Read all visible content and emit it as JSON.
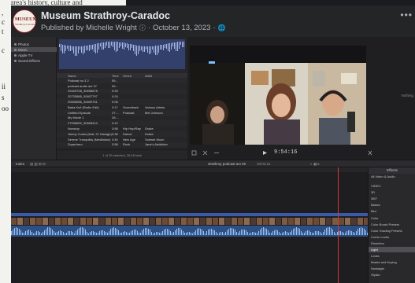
{
  "background_article": {
    "top_text": "the area's history, culture and",
    "fragments": [
      ",",
      "c",
      "t",
      "c",
      "ii",
      "s",
      "oo"
    ]
  },
  "post": {
    "logo": {
      "line1": "MUSEUM",
      "line2": "Strathroy-Caradoc"
    },
    "page_name": "Museum Strathroy-Caradoc",
    "published_by": "Published by Michelle Wright",
    "date": "October 13, 2023",
    "more_label": "•••"
  },
  "editor": {
    "sidebar": [
      {
        "label": "Photos"
      },
      {
        "label": "Music"
      },
      {
        "label": "Apple TV"
      },
      {
        "label": "Sound Effects"
      }
    ],
    "browser": {
      "columns": [
        "Name",
        "Time",
        "Genre",
        "Artist"
      ],
      "rows": [
        [
          "Podcast no 3 2",
          "59...",
          "",
          ""
        ],
        [
          "podcast audio act 37",
          "59...",
          "",
          ""
        ],
        [
          "20426708_30896878",
          "0:25",
          "",
          ""
        ],
        [
          "20733885_30807797",
          "0:24",
          "",
          ""
        ],
        [
          "20635086_30809751",
          "0:06",
          "",
          ""
        ],
        [
          "Baba Kufi (Radio Edit)",
          "3:17",
          "Soundtrack",
          "Various Artists"
        ],
        [
          "Untitled Episode",
          "27:...",
          "Podcast",
          "Mel Johnson"
        ],
        [
          "My Movie 1",
          "26:...",
          "",
          ""
        ],
        [
          "27096652_30808410",
          "0:12",
          "",
          ""
        ],
        [
          "Nonstop",
          "3:58",
          "Hip Hop/Rap",
          "Drake"
        ],
        [
          "Jimmy Cooks (feat. 21 Savage)",
          "3:38",
          "Dance",
          "Drake"
        ],
        [
          "Serene Tranquility (Meditation)",
          "3:40",
          "New Age",
          "Soleste Moon"
        ],
        [
          "Superhero",
          "3:58",
          "Rock",
          "Jane's Addiction"
        ]
      ],
      "status": "1 of 25 selected, 26:18 total"
    },
    "viewer": {
      "side_text": "Nothing",
      "timecode": "9:54:16"
    },
    "timeline_bar": {
      "left_label": "Index",
      "project_label": "strathroy podcast act 25",
      "duration": "10:01:21"
    },
    "effects": {
      "title": "Effects",
      "subtitle": "All Video & Audio",
      "items": [
        "VIDEO",
        "3D",
        "360°",
        "Basics",
        "Blur",
        "Color",
        "Color Board Presets",
        "Color Grading Presets",
        "Comic Looks",
        "Distortion",
        "Light",
        "Looks",
        "Masks and Keying",
        "Nostalgia",
        "Stylize"
      ],
      "selected": "Light"
    },
    "timeline_clip": {
      "label": "strathroy podcast act 25"
    }
  },
  "colors": {
    "accent_blue": "#3b5ba8",
    "playhead": "#d23a3a",
    "audio": "#2c4f86"
  }
}
